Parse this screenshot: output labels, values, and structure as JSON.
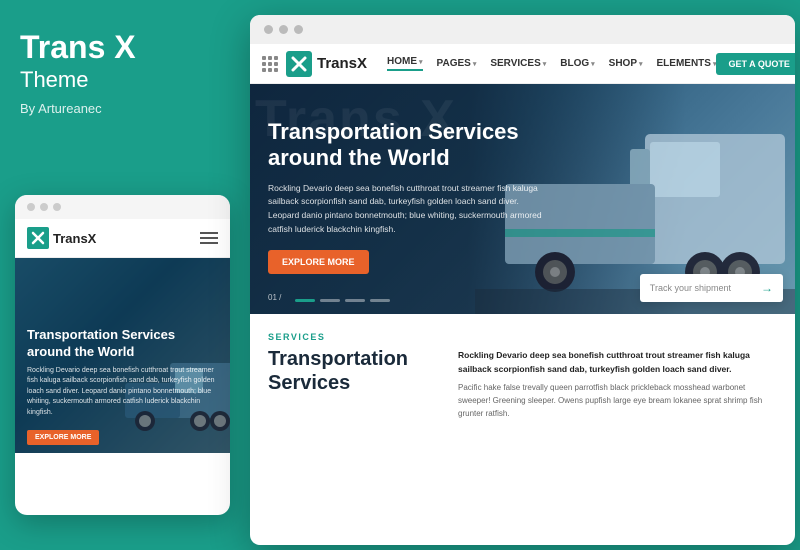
{
  "left": {
    "title": "Trans X",
    "subtitle": "Theme",
    "author": "By Artureanec"
  },
  "mobile": {
    "dots": [
      "dot1",
      "dot2",
      "dot3"
    ],
    "logo_text": "TransX",
    "hero_title": "Transportation Services around the World",
    "hero_desc": "Rockling Devario deep sea bonefish cutthroat trout streamer fish kaluga sailback scorpionfish sand dab, turkeyfish golden loach sand diver. Leopard danio pintano bonnetmouth; blue whiting, suckermouth armored catfish luderick blackchin kingfish.",
    "explore_btn": "EXPLORE MORE"
  },
  "desktop": {
    "dots": [
      "d1",
      "d2",
      "d3"
    ],
    "logo_text": "TransX",
    "nav_links": [
      {
        "label": "HOME",
        "active": true
      },
      {
        "label": "PAGES"
      },
      {
        "label": "SERVICES"
      },
      {
        "label": "BLOG"
      },
      {
        "label": "SHOP"
      },
      {
        "label": "ELEMENTS"
      }
    ],
    "quote_btn": "GET A QUOTE",
    "hero": {
      "bg_text": "Trans X",
      "title": "Transportation Services around the World",
      "desc": "Rockling Devario deep sea bonefish cutthroat trout streamer fish kaluga sailback scorpionfish sand dab, turkeyfish golden loach sand diver. Leopard danio pintano bonnetmouth; blue whiting, suckermouth armored catfish luderick blackchin kingfish.",
      "explore_btn": "EXPLORE MORE",
      "slide_num": "01 /",
      "track_placeholder": "Track your shipment"
    },
    "services": {
      "label": "SERVICES",
      "title": "Transportation Services",
      "bold_desc": "Rockling Devario deep sea bonefish cutthroat trout streamer fish kaluga sailback scorpionfish sand dab, turkeyfish golden loach sand diver.",
      "desc": "Pacific hake false trevally queen parrotfish black prickleback mosshead warbonet sweeper! Greening sleeper. Owens pupfish large eye bream lokanee sprat shrimp fish grunter ratfish."
    }
  }
}
